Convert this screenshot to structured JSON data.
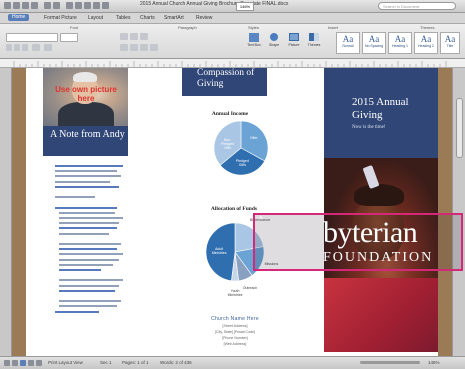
{
  "window": {
    "title": "2015 Annual Church Annual Giving Brochure Template FINAL.docx",
    "search_placeholder": "Search in Document",
    "zoom": "146%"
  },
  "ribbon": {
    "tabs": [
      "Home",
      "Format Picture",
      "Layout",
      "Tables",
      "Charts",
      "SmartArt",
      "Review"
    ],
    "active_tab": "Home",
    "groups": [
      "Font",
      "Paragraph",
      "Styles",
      "Insert",
      "Themes"
    ],
    "buttons": [
      "Text Box",
      "Shape",
      "Picture",
      "Themes"
    ],
    "styles": [
      "Normal",
      "No Spacing",
      "Heading 1",
      "Heading 2",
      "Title"
    ]
  },
  "document": {
    "photo_label": "Use own picture here",
    "note_title": "A Note from Andy",
    "compassion_title": "Compassion of Giving",
    "annual_income_title": "Annual Income",
    "allocation_title": "Allocation of Funds",
    "church_name": "Church Name Here",
    "address_lines": [
      "[Street Address]",
      "[City, State] [Postal Code]",
      "[Phone Number]",
      "[Web Address]"
    ],
    "annual_title": "2015 Annual Giving",
    "annual_subtitle": "Now is the time!",
    "overlay_word1": "byterian",
    "overlay_word2": "FOUNDATION"
  },
  "chart_data": [
    {
      "type": "pie",
      "title": "Annual Income",
      "categories": [
        "Offer",
        "Pledged Gifts",
        "Non-Pledged Gifts"
      ],
      "values": [
        33,
        31,
        36
      ],
      "colors": [
        "#6aa3d4",
        "#2f6fb0",
        "#a9c6e4"
      ]
    },
    {
      "type": "pie",
      "title": "Allocation of Funds",
      "categories": [
        "Benevolence",
        "Missions",
        "Outreach",
        "Youth Ministries",
        "Adult Ministries"
      ],
      "values": [
        22,
        18,
        8,
        4,
        48
      ],
      "colors": [
        "#a9c6e4",
        "#6aa3d4",
        "#8aa0c0",
        "#c8d7e8",
        "#2f6fb0"
      ]
    }
  ],
  "status": {
    "view_label": "Print Layout View",
    "sections": "Sec 1",
    "pages": "Pages: 1 of 1",
    "words": "Words: 2 of 436",
    "zoom": "146%"
  }
}
